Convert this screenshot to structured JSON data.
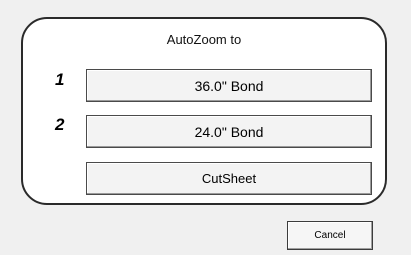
{
  "dialog": {
    "title": "AutoZoom to",
    "options": [
      {
        "number": "1",
        "label": "36.0\" Bond"
      },
      {
        "number": "2",
        "label": "24.0\" Bond"
      },
      {
        "number": "",
        "label": "CutSheet"
      }
    ],
    "cancel_label": "Cancel"
  },
  "colors": {
    "background": "#f0f0f0",
    "panel": "#ffffff",
    "border": "#2a2a2a",
    "button_face": "#f3f3f3"
  }
}
